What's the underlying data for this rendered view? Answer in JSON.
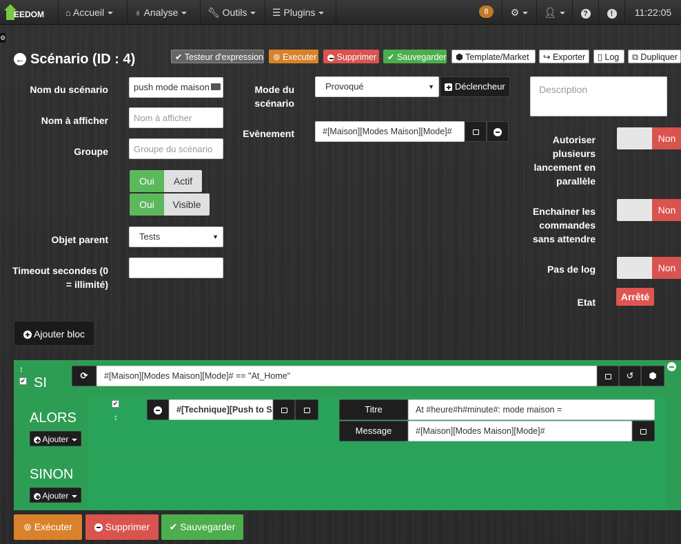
{
  "brand": {
    "logo_text": "EEDOM"
  },
  "nav": {
    "accueil": "Accueil",
    "analyse": "Analyse",
    "outils": "Outils",
    "plugins": "Plugins",
    "badge_count": "8",
    "time": "11:22:05"
  },
  "header": {
    "title": "Scénario (ID : 4)"
  },
  "toolbar": {
    "testeur": "Testeur d'expression",
    "executer": "Executer",
    "supprimer": "Supprimer",
    "sauvegarder": "Sauvegarder",
    "template": "Template/Market",
    "exporter": "Exporter",
    "log": "Log",
    "dupliquer": "Dupliquer"
  },
  "form": {
    "nom_label": "Nom du scénario",
    "nom_value": "push mode maison",
    "afficher_label": "Nom à afficher",
    "afficher_placeholder": "Nom à afficher",
    "groupe_label": "Groupe",
    "groupe_placeholder": "Groupe du scénario",
    "oui1": "Oui",
    "actif": "Actif",
    "oui2": "Oui",
    "visible": "Visible",
    "parent_label": "Objet parent",
    "parent_value": "Tests",
    "timeout_label_1": "Timeout secondes (0",
    "timeout_label_2": "= illimité)",
    "timeout_value": "",
    "mode_label_1": "Mode du",
    "mode_label_2": "scénario",
    "mode_value": "Provoqué",
    "declencheur": "Déclencheur",
    "evenement_label": "Evènement",
    "evenement_value": "#[Maison][Modes Maison][Mode]#",
    "description_placeholder": "Description",
    "autoriser_1": "Autoriser",
    "autoriser_2": "plusieurs",
    "autoriser_3": "lancement en",
    "autoriser_4": "parallèle",
    "enchainer_1": "Enchainer les",
    "enchainer_2": "commandes",
    "enchainer_3": "sans attendre",
    "pasdelog": "Pas de log",
    "etat_label": "Etat",
    "etat_value": "Arrêté",
    "non1": "Non",
    "non2": "Non",
    "non3": "Non"
  },
  "ajouter_bloc": "Ajouter bloc",
  "block": {
    "si": "SI",
    "condition": "#[Maison][Modes Maison][Mode]# == \"At_Home\"",
    "alors": "ALORS",
    "sinon": "SINON",
    "ajouter": "Ajouter",
    "ajouter2": "Ajouter",
    "action_cmd": "#[Technique][Push to Se",
    "titre_label": "Titre",
    "titre_value": "At #heure#h#minute#: mode maison =",
    "message_label": "Message",
    "message_value": "#[Maison][Modes Maison][Mode]#"
  },
  "footer": {
    "executer": "Exécuter",
    "supprimer": "Supprimer",
    "sauvegarder": "Sauvegarder"
  },
  "colors": {
    "green": "#5cb85c",
    "red": "#d9534f",
    "orange": "#f0ad4e",
    "block_green": "#2e9d54"
  }
}
